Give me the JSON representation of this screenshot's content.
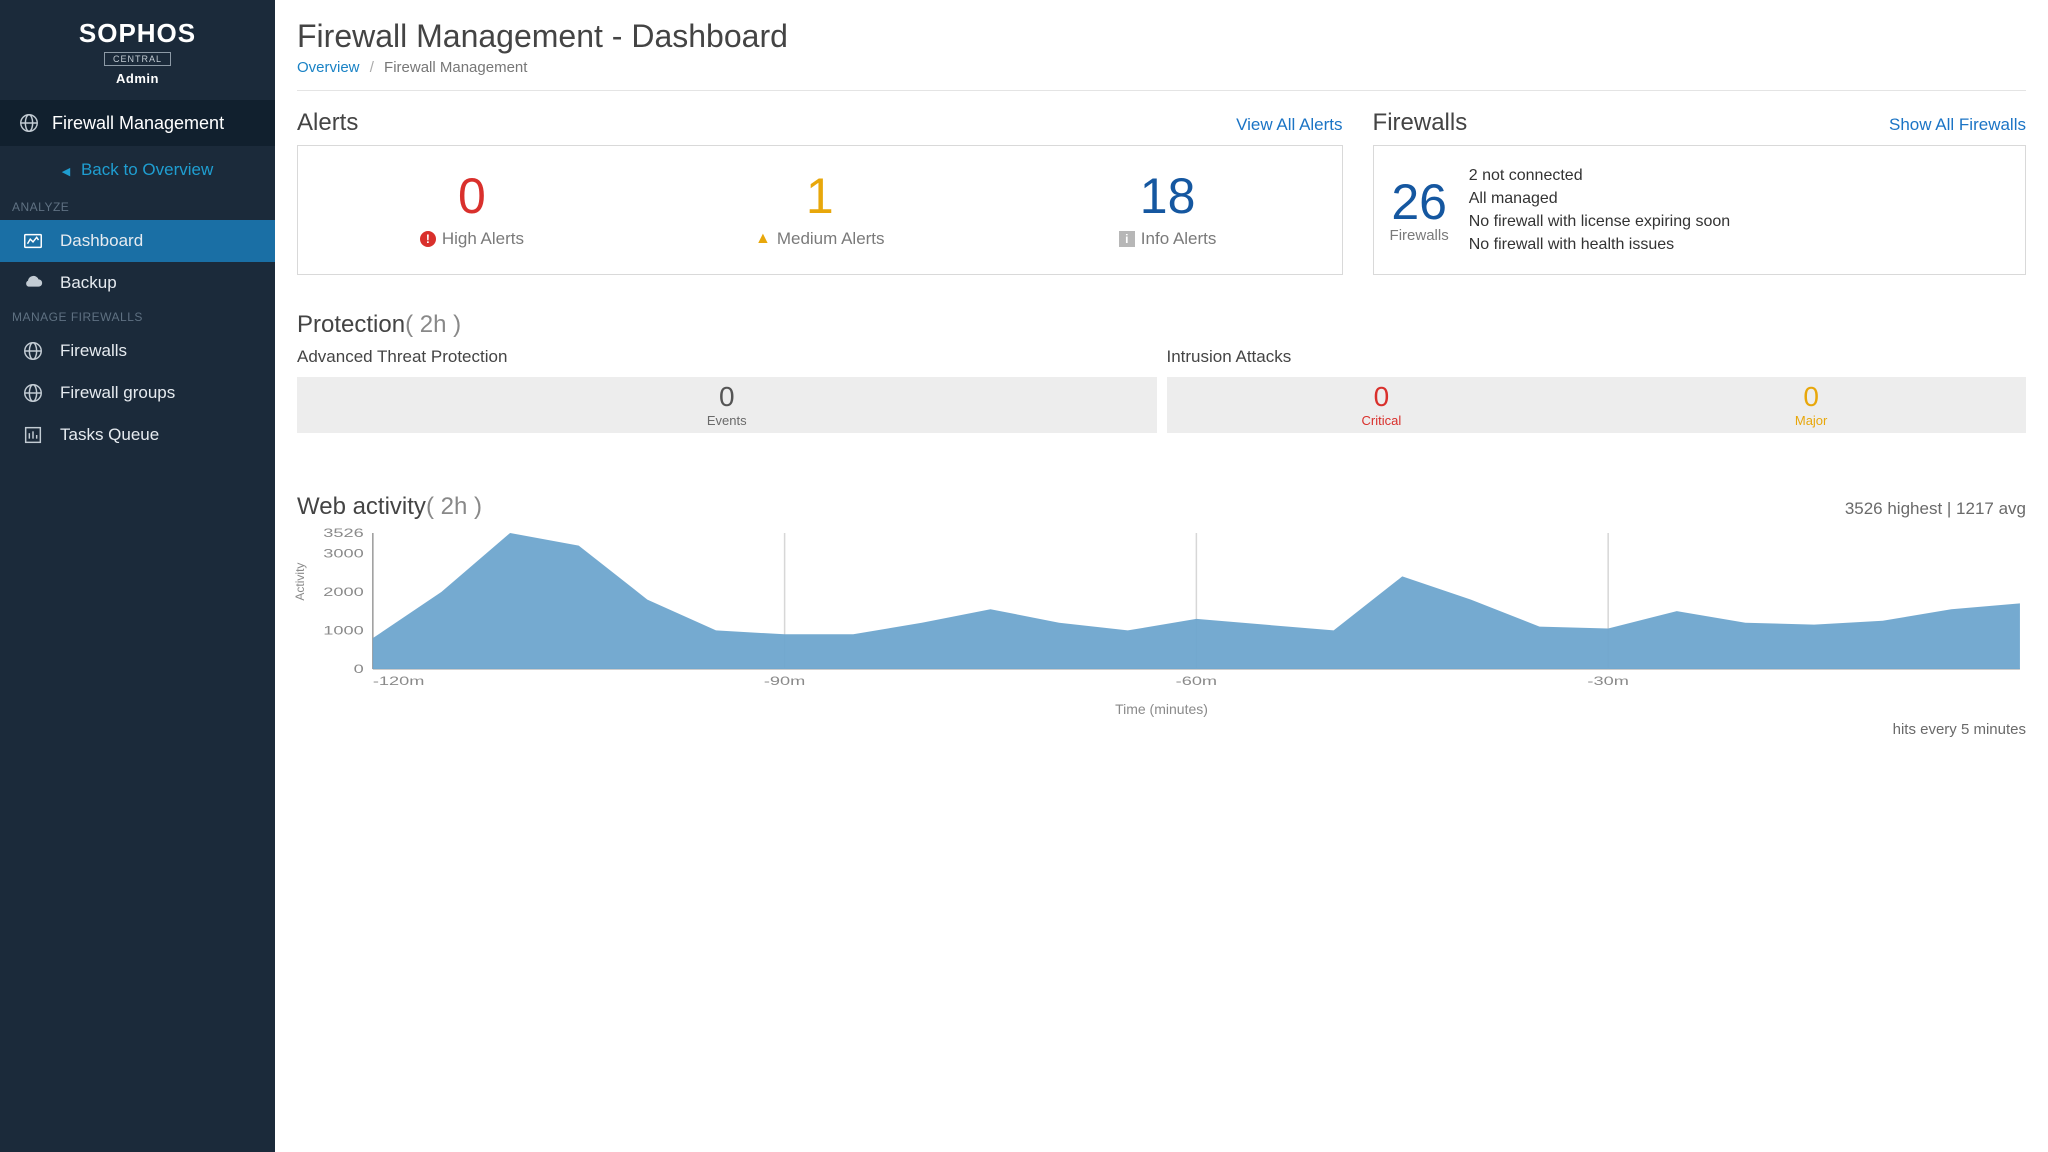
{
  "brand": {
    "name": "SOPHOS",
    "tier": "CENTRAL",
    "role": "Admin"
  },
  "sidebar": {
    "title": "Firewall Management",
    "back": "Back to Overview",
    "groups": {
      "analyze": {
        "label": "ANALYZE",
        "items": {
          "dashboard": "Dashboard",
          "backup": "Backup"
        }
      },
      "manage": {
        "label": "MANAGE FIREWALLS",
        "items": {
          "firewalls": "Firewalls",
          "groups": "Firewall groups",
          "tasks": "Tasks Queue"
        }
      }
    }
  },
  "header": {
    "title": "Firewall Management - Dashboard",
    "breadcrumb": {
      "overview": "Overview",
      "current": "Firewall Management"
    }
  },
  "alerts": {
    "title": "Alerts",
    "view_all": "View All Alerts",
    "high": {
      "value": "0",
      "label": "High Alerts"
    },
    "medium": {
      "value": "1",
      "label": "Medium Alerts"
    },
    "info": {
      "value": "18",
      "label": "Info Alerts"
    }
  },
  "firewalls": {
    "title": "Firewalls",
    "show_all": "Show All Firewalls",
    "count": "26",
    "count_label": "Firewalls",
    "lines": {
      "l1": "2 not connected",
      "l2": "All managed",
      "l3": "No firewall with license expiring soon",
      "l4": "No firewall with health issues"
    }
  },
  "protection": {
    "title_prefix": "Protection",
    "title_suffix": "( 2h )",
    "atp_label": "Advanced Threat Protection",
    "intrusion_label": "Intrusion Attacks",
    "atp": {
      "value": "0",
      "label": "Events"
    },
    "critical": {
      "value": "0",
      "label": "Critical"
    },
    "major": {
      "value": "0",
      "label": "Major"
    }
  },
  "web": {
    "title_prefix": "Web activity",
    "title_suffix": "( 2h )",
    "stats": "3526 highest | 1217 avg",
    "ylabel": "Activity",
    "xlabel": "Time (minutes)",
    "sub": "hits every 5 minutes"
  },
  "chart_data": {
    "type": "area",
    "title": "Web activity (2h)",
    "xlabel": "Time (minutes)",
    "ylabel": "Activity",
    "ylim": [
      0,
      3526
    ],
    "x_ticks": [
      "-120m",
      "-90m",
      "-60m",
      "-30m"
    ],
    "y_ticks": [
      0,
      1000,
      2000,
      3000,
      3526
    ],
    "highest": 3526,
    "avg": 1217,
    "note": "hits every 5 minutes",
    "x": [
      -120,
      -115,
      -110,
      -105,
      -100,
      -95,
      -90,
      -85,
      -80,
      -75,
      -70,
      -65,
      -60,
      -55,
      -50,
      -45,
      -40,
      -35,
      -30,
      -25,
      -20,
      -15,
      -10,
      -5,
      0
    ],
    "values": [
      800,
      2000,
      3526,
      3200,
      1800,
      1000,
      900,
      900,
      1200,
      1550,
      1200,
      1000,
      1300,
      1150,
      1000,
      2400,
      1800,
      1100,
      1050,
      1500,
      1200,
      1150,
      1250,
      1550,
      1700
    ]
  }
}
